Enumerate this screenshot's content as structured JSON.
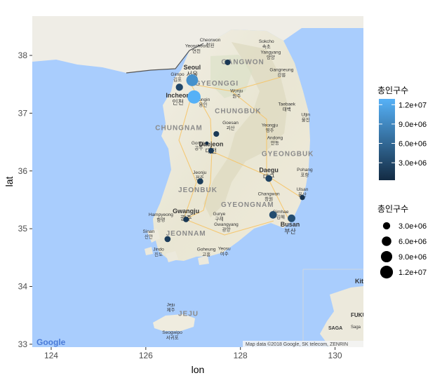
{
  "chart_data": {
    "type": "scatter",
    "title": "",
    "xlabel": "lon",
    "ylabel": "lat",
    "xlim": [
      123.6,
      130.6
    ],
    "ylim": [
      32.95,
      38.68
    ],
    "x_ticks": [
      124,
      126,
      128,
      130
    ],
    "y_ticks": [
      33,
      34,
      35,
      36,
      37,
      38
    ],
    "x_tick_labels": [
      "124",
      "126",
      "128",
      "130"
    ],
    "y_tick_labels": [
      "33",
      "34",
      "35",
      "36",
      "37",
      "38"
    ],
    "grid": false,
    "legend_position": "right",
    "size_legend": {
      "title": "총인구수",
      "breaks": [
        3000000,
        6000000,
        9000000,
        12000000
      ],
      "labels": [
        "3.0e+06",
        "6.0e+06",
        "9.0e+06",
        "1.2e+07"
      ]
    },
    "color_legend": {
      "title": "총인구수",
      "low_color": "#132B43",
      "high_color": "#56B1F7",
      "breaks": [
        3000000,
        6000000,
        9000000,
        12000000
      ],
      "labels": [
        "3.0e+06",
        "6.0e+06",
        "9.0e+06",
        "1.2e+07"
      ],
      "min": 290000,
      "max": 12900000
    },
    "points": [
      {
        "lon": 126.98,
        "lat": 37.57,
        "value": 9900000
      },
      {
        "lon": 127.02,
        "lat": 37.28,
        "value": 12900000
      },
      {
        "lon": 126.71,
        "lat": 37.45,
        "value": 2950000
      },
      {
        "lon": 127.73,
        "lat": 37.88,
        "value": 1550000
      },
      {
        "lon": 127.49,
        "lat": 36.64,
        "value": 1590000
      },
      {
        "lon": 127.38,
        "lat": 36.35,
        "value": 1510000
      },
      {
        "lon": 127.29,
        "lat": 36.48,
        "value": 290000
      },
      {
        "lon": 127.15,
        "lat": 35.82,
        "value": 1850000
      },
      {
        "lon": 126.85,
        "lat": 35.16,
        "value": 1460000
      },
      {
        "lon": 126.46,
        "lat": 34.82,
        "value": 1900000
      },
      {
        "lon": 128.6,
        "lat": 35.87,
        "value": 2480000
      },
      {
        "lon": 128.69,
        "lat": 35.24,
        "value": 3370000
      },
      {
        "lon": 129.08,
        "lat": 35.18,
        "value": 3470000
      },
      {
        "lon": 129.31,
        "lat": 35.54,
        "value": 1170000
      }
    ]
  },
  "map": {
    "attribution": "Map data ©2018 Google, SK telecom, ZENRIN",
    "google_logo": "Google",
    "cities": [
      {
        "name": "Seoul",
        "local": "서울",
        "lon": 126.98,
        "lat": 37.76,
        "bold": true
      },
      {
        "name": "Incheon",
        "local": "인천",
        "lon": 126.68,
        "lat": 37.27,
        "bold": true
      },
      {
        "name": "Yongin",
        "local": "용인",
        "lon": 127.21,
        "lat": 37.21,
        "bold": false
      },
      {
        "name": "Gimpo",
        "local": "김포",
        "lon": 126.67,
        "lat": 37.65,
        "bold": false
      },
      {
        "name": "Yeoncheon",
        "local": "연천",
        "lon": 127.07,
        "lat": 38.14,
        "bold": false
      },
      {
        "name": "Cheorwon",
        "local": "철원",
        "lon": 127.36,
        "lat": 38.24,
        "bold": false
      },
      {
        "name": "Sokcho",
        "local": "속초",
        "lon": 128.55,
        "lat": 38.22,
        "bold": false
      },
      {
        "name": "Yangyang",
        "local": "양양",
        "lon": 128.64,
        "lat": 38.03,
        "bold": false
      },
      {
        "name": "Gangneung",
        "local": "강릉",
        "lon": 128.87,
        "lat": 37.73,
        "bold": false
      },
      {
        "name": "Taebaek",
        "local": "태백",
        "lon": 128.98,
        "lat": 37.13,
        "bold": false
      },
      {
        "name": "Wonju",
        "local": "원주",
        "lon": 127.92,
        "lat": 37.36,
        "bold": false
      },
      {
        "name": "Uljin",
        "local": "울진",
        "lon": 129.38,
        "lat": 36.95,
        "bold": false
      },
      {
        "name": "Yeongju",
        "local": "영주",
        "lon": 128.62,
        "lat": 36.77,
        "bold": false
      },
      {
        "name": "Goesan",
        "local": "괴산",
        "lon": 127.79,
        "lat": 36.81,
        "bold": false
      },
      {
        "name": "Andong",
        "local": "안동",
        "lon": 128.73,
        "lat": 36.55,
        "bold": false
      },
      {
        "name": "Gongju",
        "local": "공주",
        "lon": 127.12,
        "lat": 36.46,
        "bold": false
      },
      {
        "name": "Daejeon",
        "local": "대전",
        "lon": 127.38,
        "lat": 36.43,
        "bold": true
      },
      {
        "name": "Jeonju",
        "local": "전주",
        "lon": 127.14,
        "lat": 35.95,
        "bold": false
      },
      {
        "name": "Daegu",
        "local": "대구",
        "lon": 128.6,
        "lat": 35.98,
        "bold": true
      },
      {
        "name": "Pohang",
        "local": "포항",
        "lon": 129.36,
        "lat": 36.0,
        "bold": false
      },
      {
        "name": "Ulsan",
        "local": "울산",
        "lon": 129.31,
        "lat": 35.66,
        "bold": false
      },
      {
        "name": "Changwon",
        "local": "창원",
        "lon": 128.6,
        "lat": 35.58,
        "bold": false
      },
      {
        "name": "Gimhae",
        "local": "김해",
        "lon": 128.85,
        "lat": 35.27,
        "bold": false
      },
      {
        "name": "Busan",
        "local": "부산",
        "lon": 129.05,
        "lat": 35.04,
        "bold": true
      },
      {
        "name": "Gwangju",
        "local": "광주",
        "lon": 126.85,
        "lat": 35.27,
        "bold": true
      },
      {
        "name": "Hampyeong",
        "local": "함평",
        "lon": 126.32,
        "lat": 35.22,
        "bold": false
      },
      {
        "name": "Gurye",
        "local": "구례",
        "lon": 127.55,
        "lat": 35.23,
        "bold": false
      },
      {
        "name": "Gwangyang",
        "local": "광양",
        "lon": 127.7,
        "lat": 35.05,
        "bold": false
      },
      {
        "name": "Sinan",
        "local": "신안",
        "lon": 126.06,
        "lat": 34.93,
        "bold": false
      },
      {
        "name": "Jindo",
        "local": "진도",
        "lon": 126.27,
        "lat": 34.62,
        "bold": false
      },
      {
        "name": "Goheung",
        "local": "고흥",
        "lon": 127.28,
        "lat": 34.62,
        "bold": false
      },
      {
        "name": "Yeosu",
        "local": "여수",
        "lon": 127.66,
        "lat": 34.63,
        "bold": false
      },
      {
        "name": "Jeju",
        "local": "제주",
        "lon": 126.53,
        "lat": 33.66,
        "bold": false
      },
      {
        "name": "Seogwipo",
        "local": "서귀포",
        "lon": 126.56,
        "lat": 33.18,
        "bold": false
      }
    ],
    "regions": [
      {
        "name": "GANGWON",
        "lon": 128.05,
        "lat": 37.85
      },
      {
        "name": "GYEONGGI",
        "lon": 127.5,
        "lat": 37.48
      },
      {
        "name": "CHUNGBUK",
        "lon": 127.95,
        "lat": 37.0
      },
      {
        "name": "CHUNGNAM",
        "lon": 126.7,
        "lat": 36.71
      },
      {
        "name": "GYEONGBUK",
        "lon": 129.0,
        "lat": 36.26
      },
      {
        "name": "JEONBUK",
        "lon": 127.1,
        "lat": 35.63
      },
      {
        "name": "GYEONGNAM",
        "lon": 128.15,
        "lat": 35.38
      },
      {
        "name": "JEONNAM",
        "lon": 126.85,
        "lat": 34.88
      },
      {
        "name": "JEJU",
        "lon": 126.9,
        "lat": 33.49
      }
    ],
    "inset_labels": [
      "Kit",
      "FUKU",
      "SAGA",
      "Saga"
    ]
  }
}
